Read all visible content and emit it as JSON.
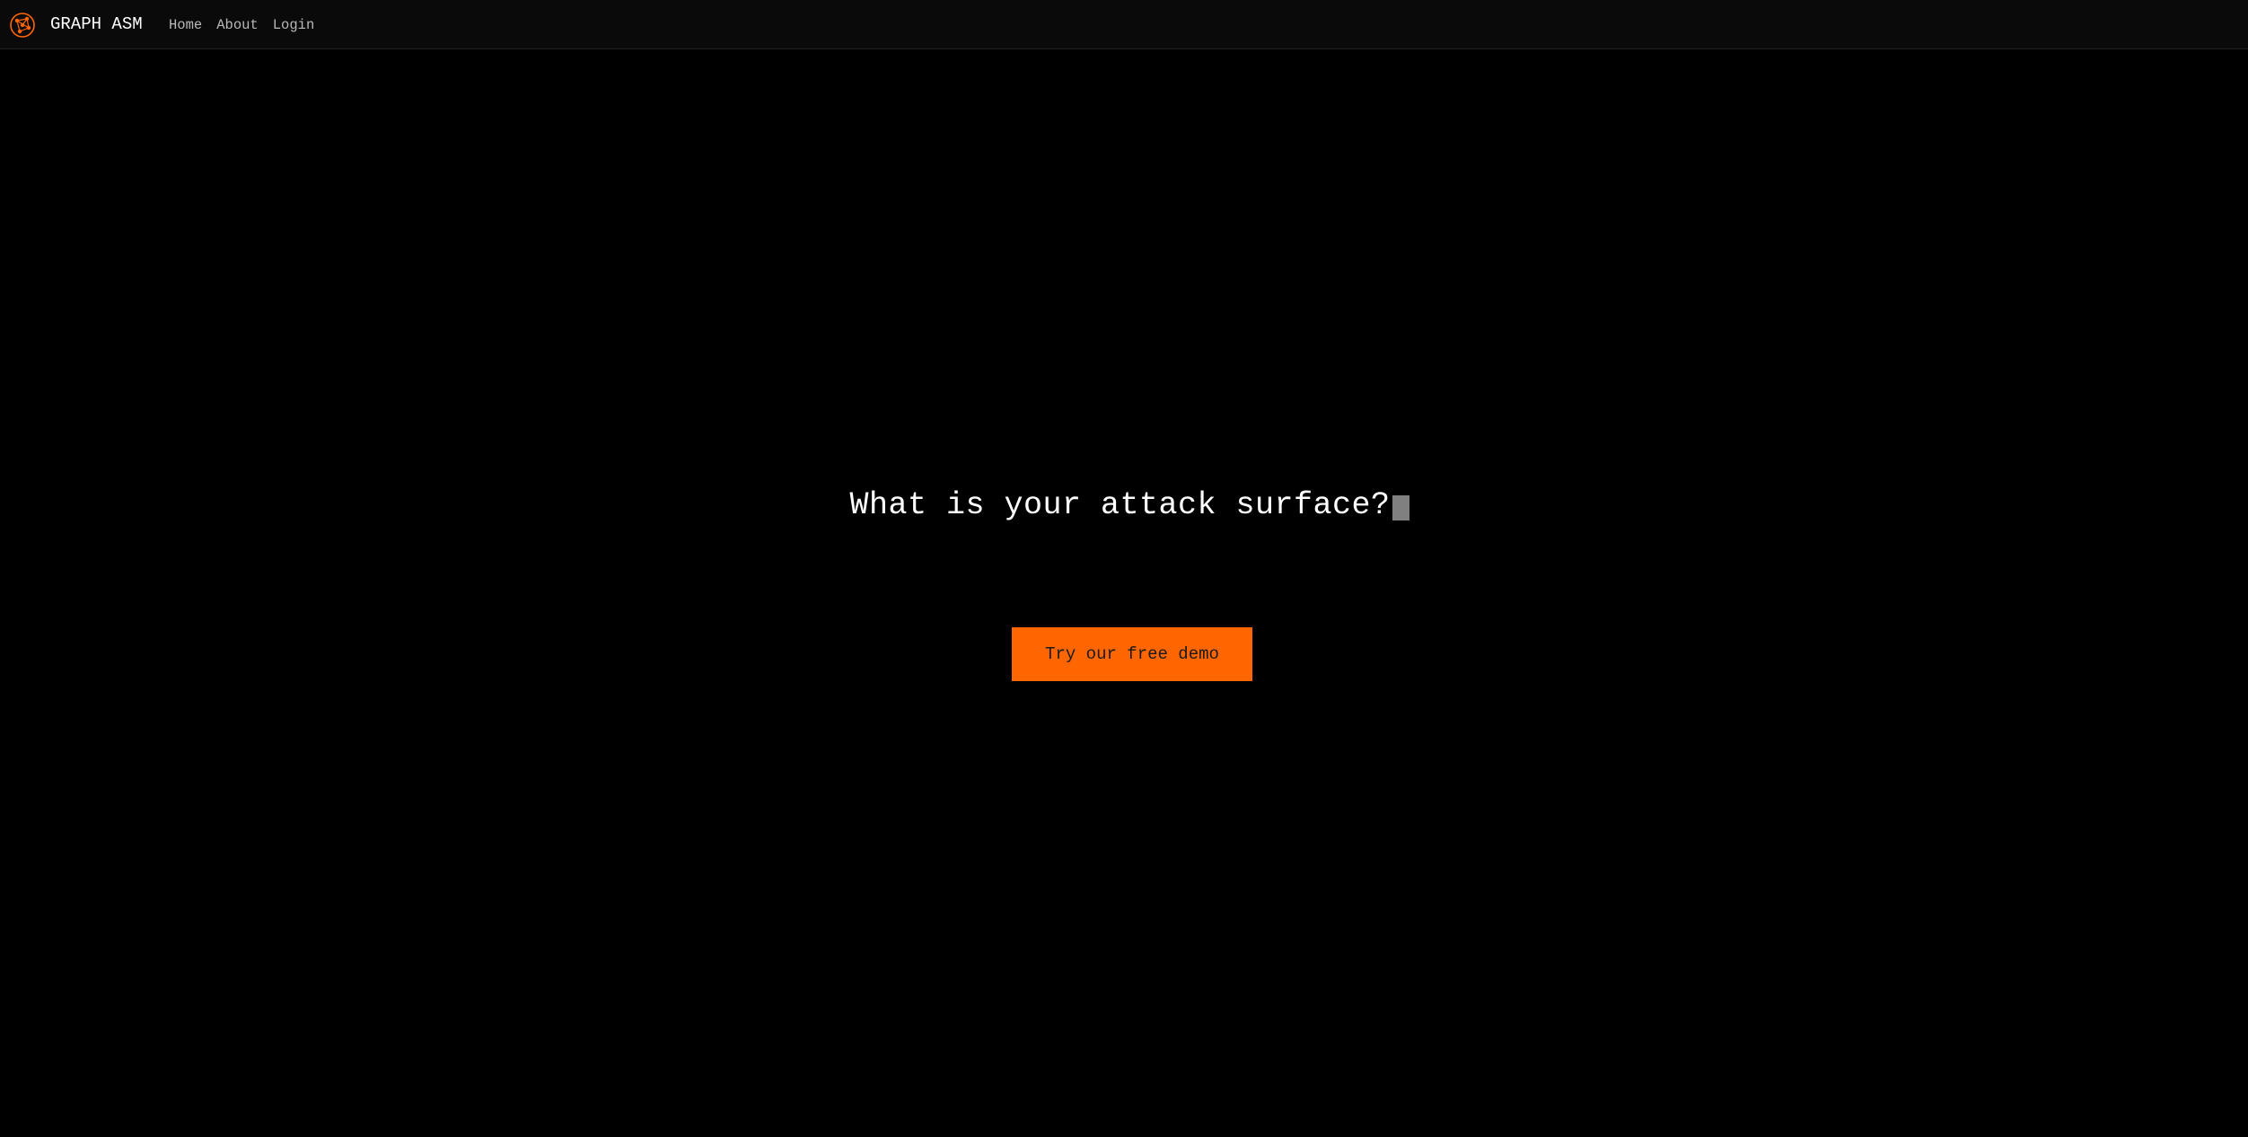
{
  "header": {
    "brand": "GRAPH ASM",
    "logo_icon": "graph-network-logo-icon",
    "nav": [
      {
        "label": "Home"
      },
      {
        "label": "About"
      },
      {
        "label": "Login"
      }
    ]
  },
  "hero": {
    "title": "What is your attack surface?",
    "cta_label": "Try our free demo"
  },
  "colors": {
    "background": "#000000",
    "accent": "#ff6600",
    "cursor": "#808080"
  }
}
